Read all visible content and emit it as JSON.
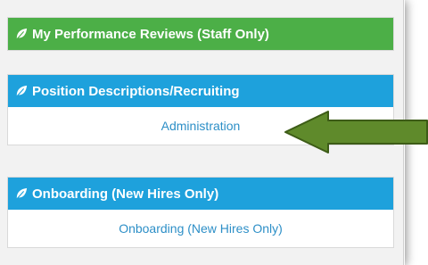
{
  "sections": [
    {
      "header": "My Performance Reviews (Staff Only)",
      "color": "#4caf47",
      "icon": "leaf-icon"
    },
    {
      "header": "Position Descriptions/Recruiting",
      "color": "#1ea1dc",
      "icon": "leaf-icon",
      "link": "Administration"
    },
    {
      "header": "Onboarding (New Hires Only)",
      "color": "#1ea1dc",
      "icon": "leaf-icon",
      "link": "Onboarding (New Hires Only)"
    }
  ],
  "annotation": {
    "arrow_color": "#5f8a2b",
    "points_to": "Administration"
  }
}
